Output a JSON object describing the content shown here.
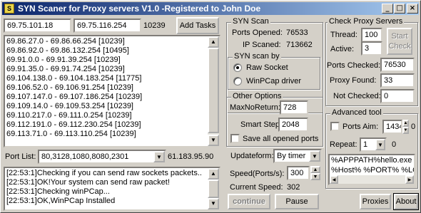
{
  "window": {
    "title": "SYN Scaner for Proxy servers V1.0 -Registered to John Doe",
    "icon_name": "app-icon",
    "controls": {
      "minimize": "_",
      "maximize": "□",
      "close": "×"
    }
  },
  "range": {
    "start_ip": "69.75.101.18",
    "end_ip": "69.75.116.254",
    "count": "10239",
    "add_tasks_label": "Add Tasks"
  },
  "task_list": [
    "69.86.27.0  -  69.86.66.254    [10239]",
    "69.86.92.0  -  69.86.132.254    [10495]",
    "69.91.0.0  -  69.91.39.254    [10239]",
    "69.91.35.0  -  69.91.74.254    [10239]",
    "69.104.138.0  -  69.104.183.254    [11775]",
    "69.106.52.0  -  69.106.91.254    [10239]",
    "69.107.147.0  -  69.107.186.254    [10239]",
    "69.109.14.0  -  69.109.53.254    [10239]",
    "69.110.217.0  -  69.111.0.254    [10239]",
    "69.112.191.0  -  69.112.230.254    [10239]",
    "69.113.71.0  -  69.113.110.254    [10239]"
  ],
  "port_list": {
    "label": "Port List:",
    "value": "80,3128,1080,8080,2301",
    "current_ip": "61.183.95.90"
  },
  "log": [
    "[22:53:1]Checking if you can send raw sockets packets..",
    "[22:53:1]OK!Your system can send raw packet!",
    "[22:53:1]Checking winPCap...",
    "[22:53:1]OK,WinPCap Installed"
  ],
  "syn_scan": {
    "title": "SYN Scan",
    "ports_opened_label": "Ports Opened:",
    "ports_opened": "76533",
    "ip_scanned_label": "IP Scaned:",
    "ip_scanned": "713662"
  },
  "syn_scan_by": {
    "title": "SYN scan by",
    "raw_socket": "Raw Socket",
    "winpcap": "WinPCap driver",
    "selected": "raw_socket"
  },
  "other_options": {
    "title": "Other Options",
    "max_no_return_label": "MaxNoReturn:",
    "max_no_return": "728",
    "smart_step_label": "Smart Step:",
    "smart_step": "2048",
    "save_all_label": "Save all opened ports",
    "save_all_checked": false
  },
  "update_form": {
    "label": "Updateform:",
    "value": "By timer"
  },
  "speed": {
    "label": "Speed(Ports/s):",
    "value": "300",
    "current_label": "Current Speed:",
    "current": "302"
  },
  "actions": {
    "continue_label": "continue",
    "pause_label": "Pause"
  },
  "check_proxy": {
    "title": "Check  Proxy Servers",
    "thread_label": "Thread:",
    "thread": "100",
    "active_label": "Active:",
    "active": "3",
    "start_check_label": "Start Check",
    "ports_checked_label": "Ports Checked:",
    "ports_checked": "76530",
    "proxy_found_label": "Proxy Found:",
    "proxy_found": "33",
    "not_checked_label": "Not Checked:",
    "not_checked": "0"
  },
  "advanced_tool": {
    "title": "Advanced tool",
    "ports_aim_label": "Ports Aim:",
    "ports_aim_checked": false,
    "ports_aim_value": "1434",
    "ports_aim_count": "0",
    "repeat_label": "Repeat:",
    "repeat_value": "1",
    "repeat_count": "0",
    "command_lines": [
      "%APPPATH%hello.exe",
      "%Host% %PORT% %LO"
    ]
  },
  "footer": {
    "proxies_label": "Proxies",
    "about_label": "About"
  }
}
